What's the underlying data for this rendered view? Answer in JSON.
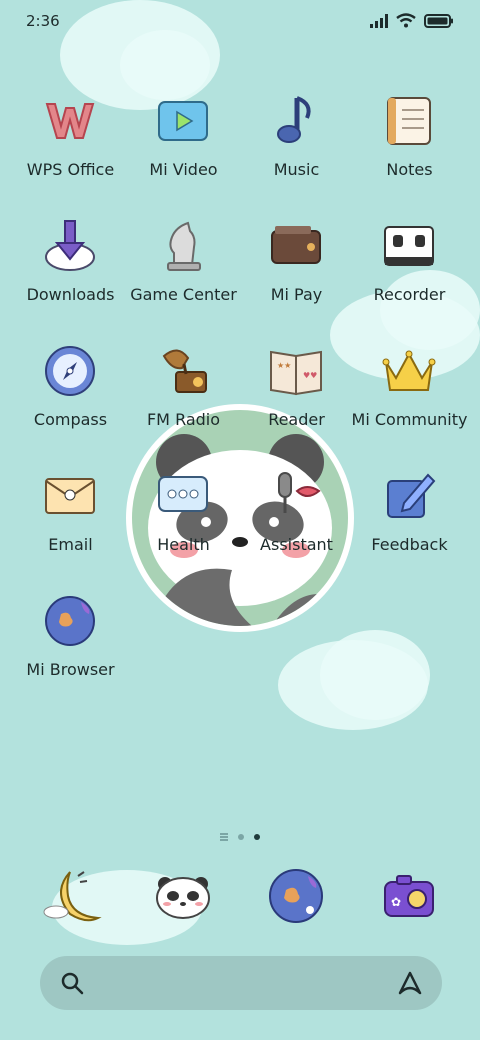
{
  "status": {
    "time": "2:36"
  },
  "apps": [
    {
      "id": "wps-office",
      "label": "WPS Office"
    },
    {
      "id": "mi-video",
      "label": "Mi Video"
    },
    {
      "id": "music",
      "label": "Music"
    },
    {
      "id": "notes",
      "label": "Notes"
    },
    {
      "id": "downloads",
      "label": "Downloads"
    },
    {
      "id": "game-center",
      "label": "Game Center"
    },
    {
      "id": "mi-pay",
      "label": "Mi Pay"
    },
    {
      "id": "recorder",
      "label": "Recorder"
    },
    {
      "id": "compass",
      "label": "Compass"
    },
    {
      "id": "fm-radio",
      "label": "FM Radio"
    },
    {
      "id": "reader",
      "label": "Reader"
    },
    {
      "id": "mi-community",
      "label": "Mi Community"
    },
    {
      "id": "email",
      "label": "Email"
    },
    {
      "id": "health",
      "label": "Health"
    },
    {
      "id": "assistant",
      "label": "Assistant"
    },
    {
      "id": "feedback",
      "label": "Feedback"
    },
    {
      "id": "mi-browser",
      "label": "Mi Browser"
    }
  ],
  "pager": {
    "pages": 2,
    "active_page": 2
  },
  "colors": {
    "background": "#b3e2dd",
    "cloud": "#e9fbf9",
    "search_bar": "#9ec7c3"
  }
}
